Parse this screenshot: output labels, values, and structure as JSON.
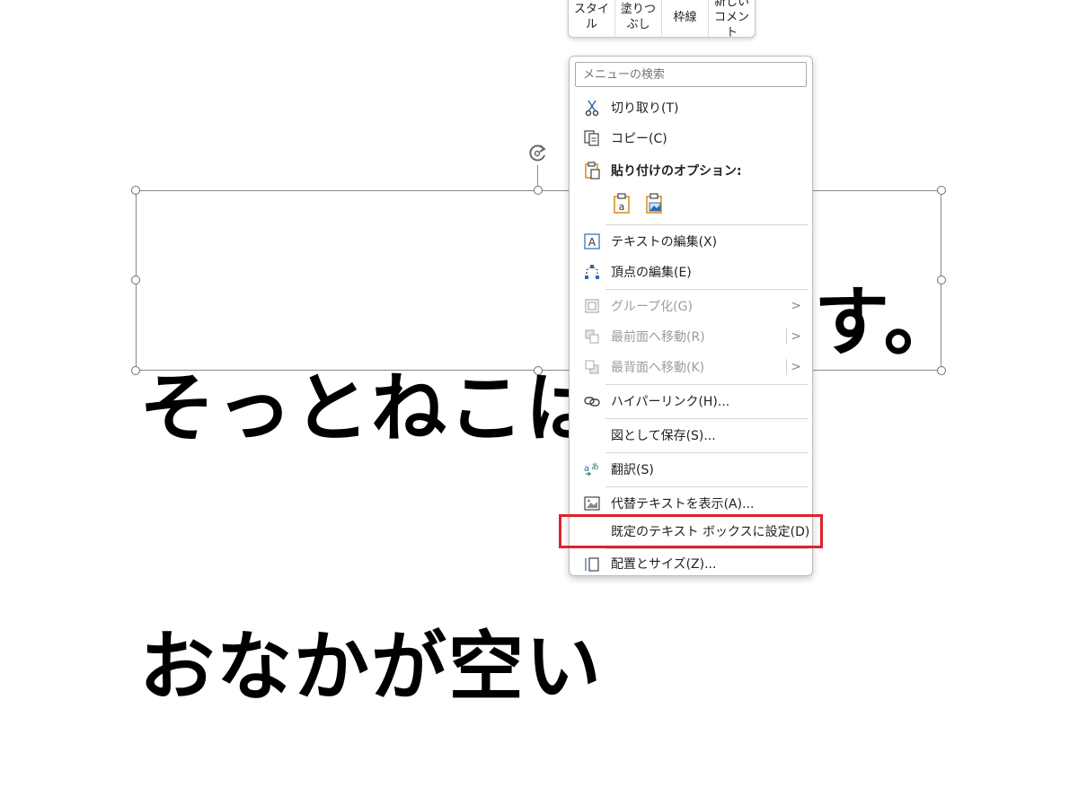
{
  "slide": {
    "text_line1": "そっとねこは",
    "text_line2": "おなかが空い",
    "text_line2_tail": "す。"
  },
  "mini_toolbar": {
    "style": "スタイ\nル",
    "fill": "塗りつ\nぶし",
    "border": "枠線",
    "new_comment": "新しい\nコメント"
  },
  "menu": {
    "search_placeholder": "メニューの検索",
    "cut": "切り取り(T)",
    "copy": "コピー(C)",
    "paste_options": "貼り付けのオプション:",
    "edit_text": "テキストの編集(X)",
    "edit_points": "頂点の編集(E)",
    "group": "グループ化(G)",
    "bring_front": "最前面へ移動(R)",
    "send_back": "最背面へ移動(K)",
    "hyperlink": "ハイパーリンク(H)...",
    "save_as_picture": "図として保存(S)...",
    "translate": "翻訳(S)",
    "alt_text": "代替テキストを表示(A)...",
    "set_default_textbox": "既定のテキスト ボックスに設定(D)",
    "size_position": "配置とサイズ(Z)..."
  },
  "colors": {
    "highlight": "#e0212b",
    "accent_blue": "#2b6cb0",
    "accent_orange": "#d88a1a"
  }
}
